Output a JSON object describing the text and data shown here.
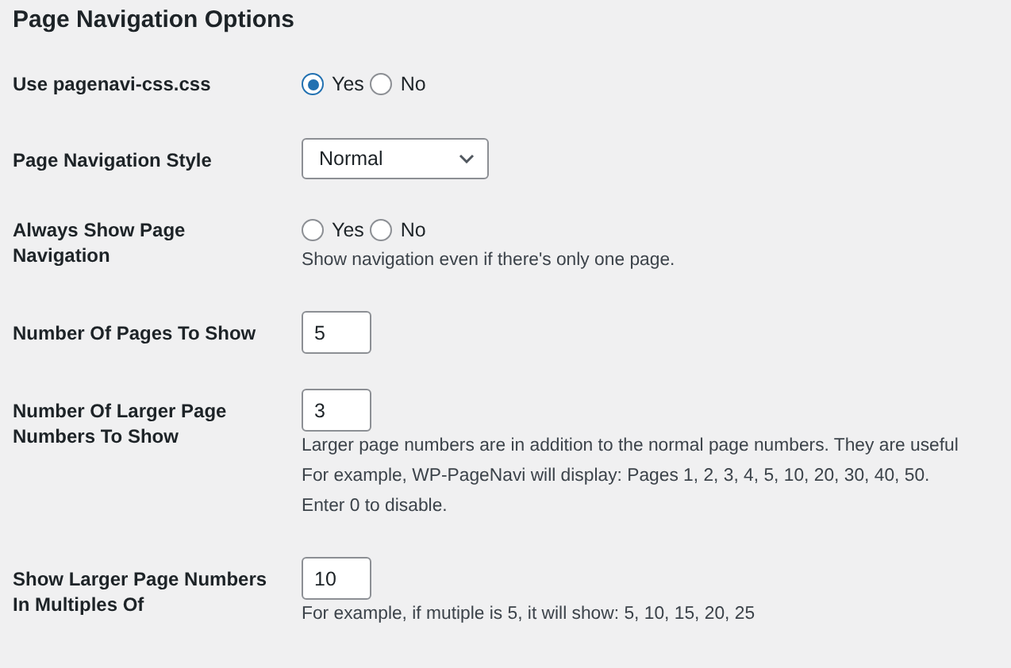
{
  "title": "Page Navigation Options",
  "rows": [
    {
      "kind": "radio",
      "label": "Use pagenavi-css.css",
      "options": [
        {
          "label": "Yes",
          "selected": true
        },
        {
          "label": "No",
          "selected": false
        }
      ]
    },
    {
      "kind": "select",
      "label": "Page Navigation Style",
      "value": "Normal"
    },
    {
      "kind": "radio",
      "label": "Always Show Page Navigation",
      "options": [
        {
          "label": "Yes",
          "selected": false
        },
        {
          "label": "No",
          "selected": false
        }
      ],
      "description": [
        "Show navigation even if there's only one page."
      ]
    },
    {
      "kind": "text",
      "label": "Number Of Pages To Show",
      "value": "5"
    },
    {
      "kind": "text",
      "label": "Number Of Larger Page Numbers To Show",
      "value": "3",
      "description": [
        "Larger page numbers are in addition to the normal page numbers. They are useful",
        "For example, WP-PageNavi will display: Pages 1, 2, 3, 4, 5, 10, 20, 30, 40, 50.",
        "Enter 0 to disable."
      ]
    },
    {
      "kind": "text",
      "label": "Show Larger Page Numbers In Multiples Of",
      "value": "10",
      "description": [
        "For example, if mutiple is 5, it will show: 5, 10, 15, 20, 25"
      ]
    }
  ]
}
